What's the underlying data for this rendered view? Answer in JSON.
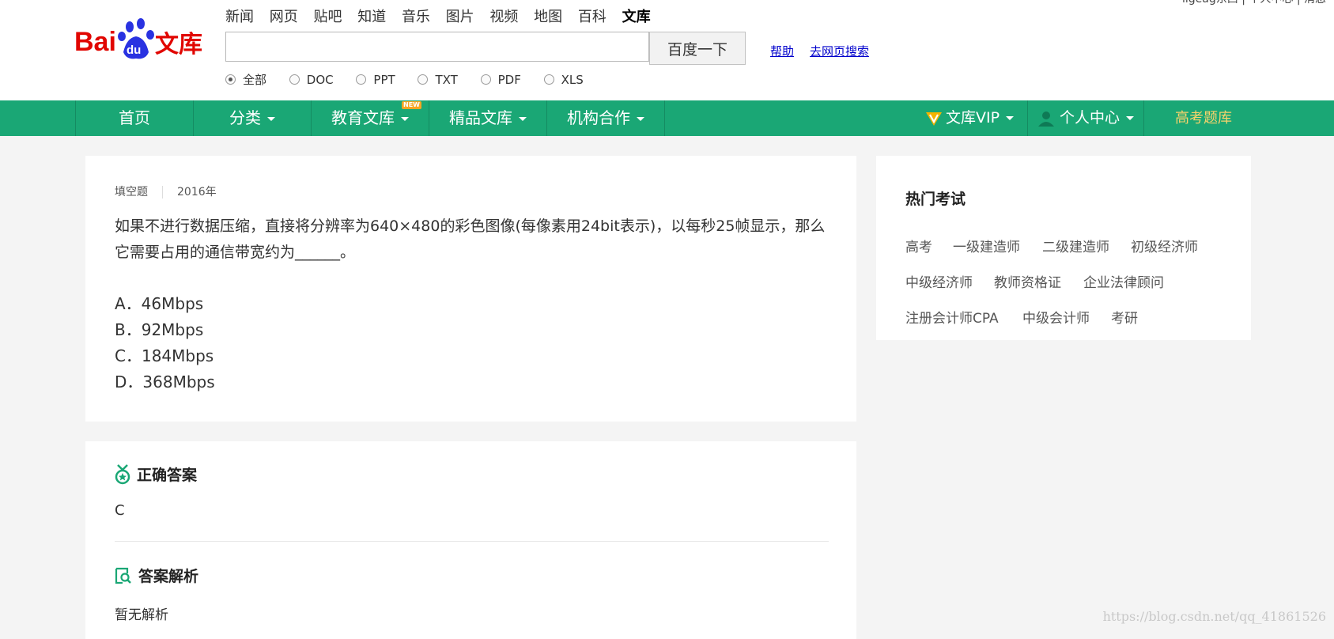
{
  "header": {
    "logo_text": "Baidu文库",
    "top_links": [
      "新闻",
      "网页",
      "贴吧",
      "知道",
      "音乐",
      "图片",
      "视频",
      "地图",
      "百科",
      "文库"
    ],
    "active_link": "文库",
    "user_strip": "ligeag东西 | 个人中心 | 消息",
    "search": {
      "value": "",
      "placeholder": "",
      "button": "百度一下"
    },
    "help": "帮助",
    "web_search": "去网页搜索",
    "filters": [
      "全部",
      "DOC",
      "PPT",
      "TXT",
      "PDF",
      "XLS"
    ],
    "selected_filter": "全部"
  },
  "nav": {
    "home": "首页",
    "category": "分类",
    "education": "教育文库",
    "new_badge": "NEW",
    "premium": "精品文库",
    "cooperation": "机构合作",
    "vip": "文库VIP",
    "personal": "个人中心",
    "gaokao": "高考题库"
  },
  "question": {
    "type": "填空题",
    "year": "2016年",
    "text": "如果不进行数据压缩，直接将分辨率为640×480的彩色图像(每像素用24bit表示)，以每秒25帧显示，那么它需要占用的通信带宽约为______。",
    "options": [
      "A．46Mbps",
      "B．92Mbps",
      "C．184Mbps",
      "D．368Mbps"
    ]
  },
  "answer": {
    "title": "正确答案",
    "value": "C",
    "analysis_title": "答案解析",
    "analysis": "暂无解析"
  },
  "sidebar": {
    "title": "热门考试",
    "exams": [
      "高考",
      "一级建造师",
      "二级建造师",
      "初级经济师",
      "中级经济师",
      "教师资格证",
      "企业法律顾问",
      "注册会计师CPA",
      "中级会计师",
      "考研"
    ]
  },
  "watermark": "https://blog.csdn.net/qq_41861526",
  "colors": {
    "nav_bg": "#1aa775",
    "gaokao": "#f7d36b",
    "vip_icon": "#f5b400",
    "accent": "#1aa775"
  }
}
